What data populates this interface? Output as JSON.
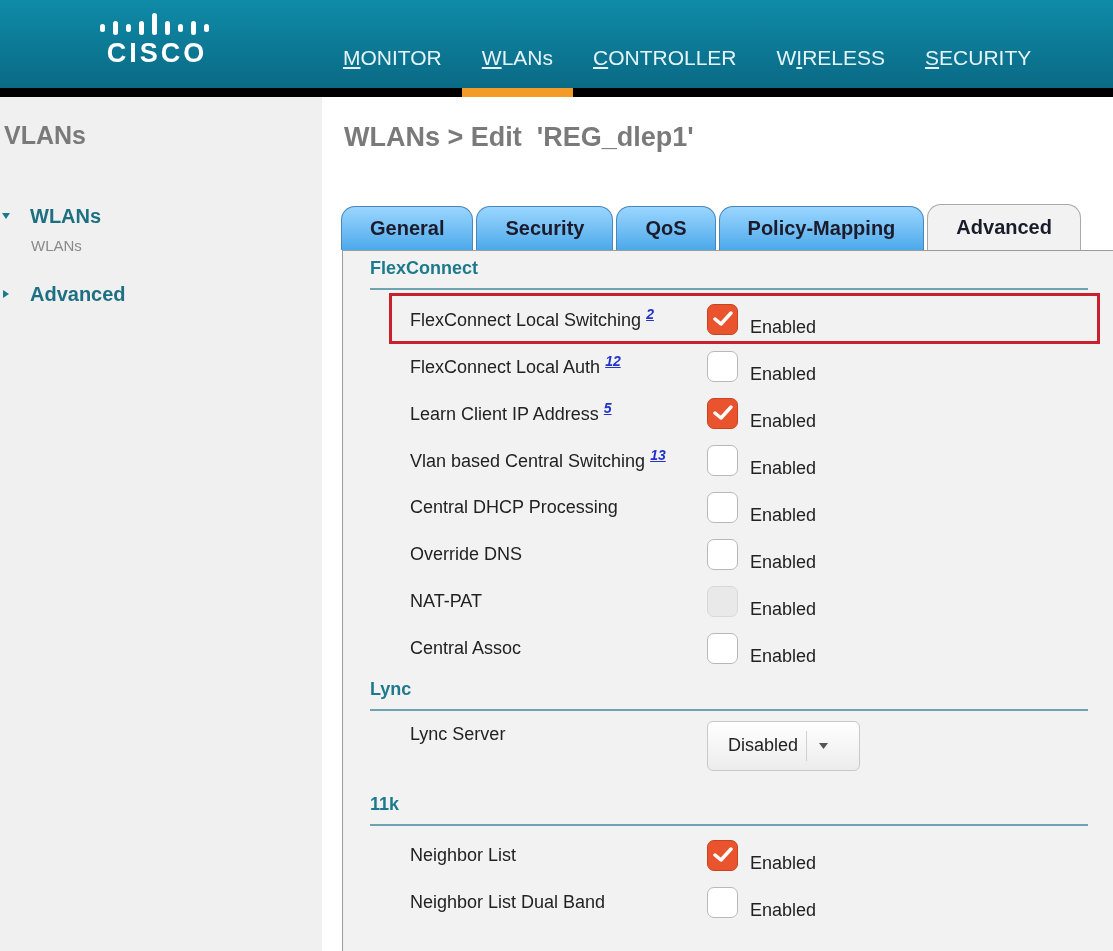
{
  "logo": "CISCO",
  "nav": [
    {
      "access_key": "M",
      "after": "ONITOR",
      "selected": false
    },
    {
      "access_key": "W",
      "after": "LANs",
      "selected": true
    },
    {
      "access_key": "C",
      "after": "ONTROLLER",
      "selected": false
    },
    {
      "before": "W",
      "access_key": "I",
      "after": "RELESS",
      "selected": false
    },
    {
      "access_key": "S",
      "after": "ECURITY",
      "selected": false
    }
  ],
  "sidebar": {
    "title": "VLANs",
    "items": [
      {
        "label": "WLANs",
        "expanded": true,
        "children": [
          {
            "label": "WLANs"
          }
        ]
      },
      {
        "label": "Advanced",
        "expanded": false
      }
    ]
  },
  "page_title": "WLANs > Edit  'REG_dlep1'",
  "tabs": [
    {
      "label": "General",
      "selected": false
    },
    {
      "label": "Security",
      "selected": false
    },
    {
      "label": "QoS",
      "selected": false
    },
    {
      "label": "Policy-Mapping",
      "selected": false
    },
    {
      "label": "Advanced",
      "selected": true
    }
  ],
  "sections": [
    {
      "title": "FlexConnect",
      "rows": [
        {
          "kind": "checkbox",
          "label": "FlexConnect Local Switching",
          "footnote": "2",
          "checked": true,
          "disabled": false,
          "highlighted": true,
          "option": "Enabled"
        },
        {
          "kind": "checkbox",
          "label": "FlexConnect Local Auth",
          "footnote": "12",
          "checked": false,
          "disabled": false,
          "highlighted": false,
          "option": "Enabled"
        },
        {
          "kind": "checkbox",
          "label": "Learn Client IP Address",
          "footnote": "5",
          "checked": true,
          "disabled": false,
          "highlighted": false,
          "option": "Enabled"
        },
        {
          "kind": "checkbox",
          "label": "Vlan based Central Switching",
          "footnote": "13",
          "checked": false,
          "disabled": false,
          "highlighted": false,
          "option": "Enabled"
        },
        {
          "kind": "checkbox",
          "label": "Central DHCP Processing",
          "checked": false,
          "disabled": false,
          "highlighted": false,
          "option": "Enabled"
        },
        {
          "kind": "checkbox",
          "label": "Override DNS",
          "checked": false,
          "disabled": false,
          "highlighted": false,
          "option": "Enabled"
        },
        {
          "kind": "checkbox",
          "label": "NAT-PAT",
          "checked": false,
          "disabled": true,
          "highlighted": false,
          "option": "Enabled"
        },
        {
          "kind": "checkbox",
          "label": "Central Assoc",
          "checked": false,
          "disabled": false,
          "highlighted": false,
          "option": "Enabled"
        }
      ]
    },
    {
      "title": "Lync",
      "rows": [
        {
          "kind": "select",
          "label": "Lync Server",
          "value": "Disabled"
        }
      ]
    },
    {
      "title": "11k",
      "rows": [
        {
          "kind": "checkbox",
          "label": "Neighbor List",
          "checked": true,
          "disabled": false,
          "highlighted": false,
          "option": "Enabled"
        },
        {
          "kind": "checkbox",
          "label": "Neighbor List Dual Band",
          "checked": false,
          "disabled": false,
          "highlighted": false,
          "option": "Enabled"
        }
      ]
    }
  ]
}
